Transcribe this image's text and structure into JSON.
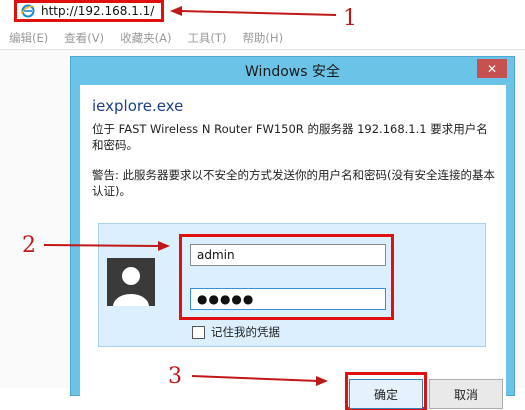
{
  "browser": {
    "address": "http://192.168.1.1/",
    "menu": [
      "编辑(E)",
      "查看(V)",
      "收藏夹(A)",
      "工具(T)",
      "帮助(H)"
    ]
  },
  "dialog": {
    "title": "Windows 安全",
    "close_label": "✕",
    "app_name": "iexplore.exe",
    "server_message": "位于 FAST Wireless N Router FW150R 的服务器 192.168.1.1 要求用户名和密码。",
    "warning_message": "警告: 此服务器要求以不安全的方式发送你的用户名和密码(没有安全连接的基本认证)。",
    "username": "admin",
    "password_mask": "●●●●●",
    "remember_label": "记住我的凭据",
    "ok_label": "确定",
    "cancel_label": "取消"
  },
  "annotations": {
    "step1": "1",
    "step2": "2",
    "step3": "3",
    "color": "#c01818"
  },
  "colors": {
    "highlight": "#e01010",
    "dialog_frame": "#6cc3e8",
    "close_button": "#c75050"
  }
}
